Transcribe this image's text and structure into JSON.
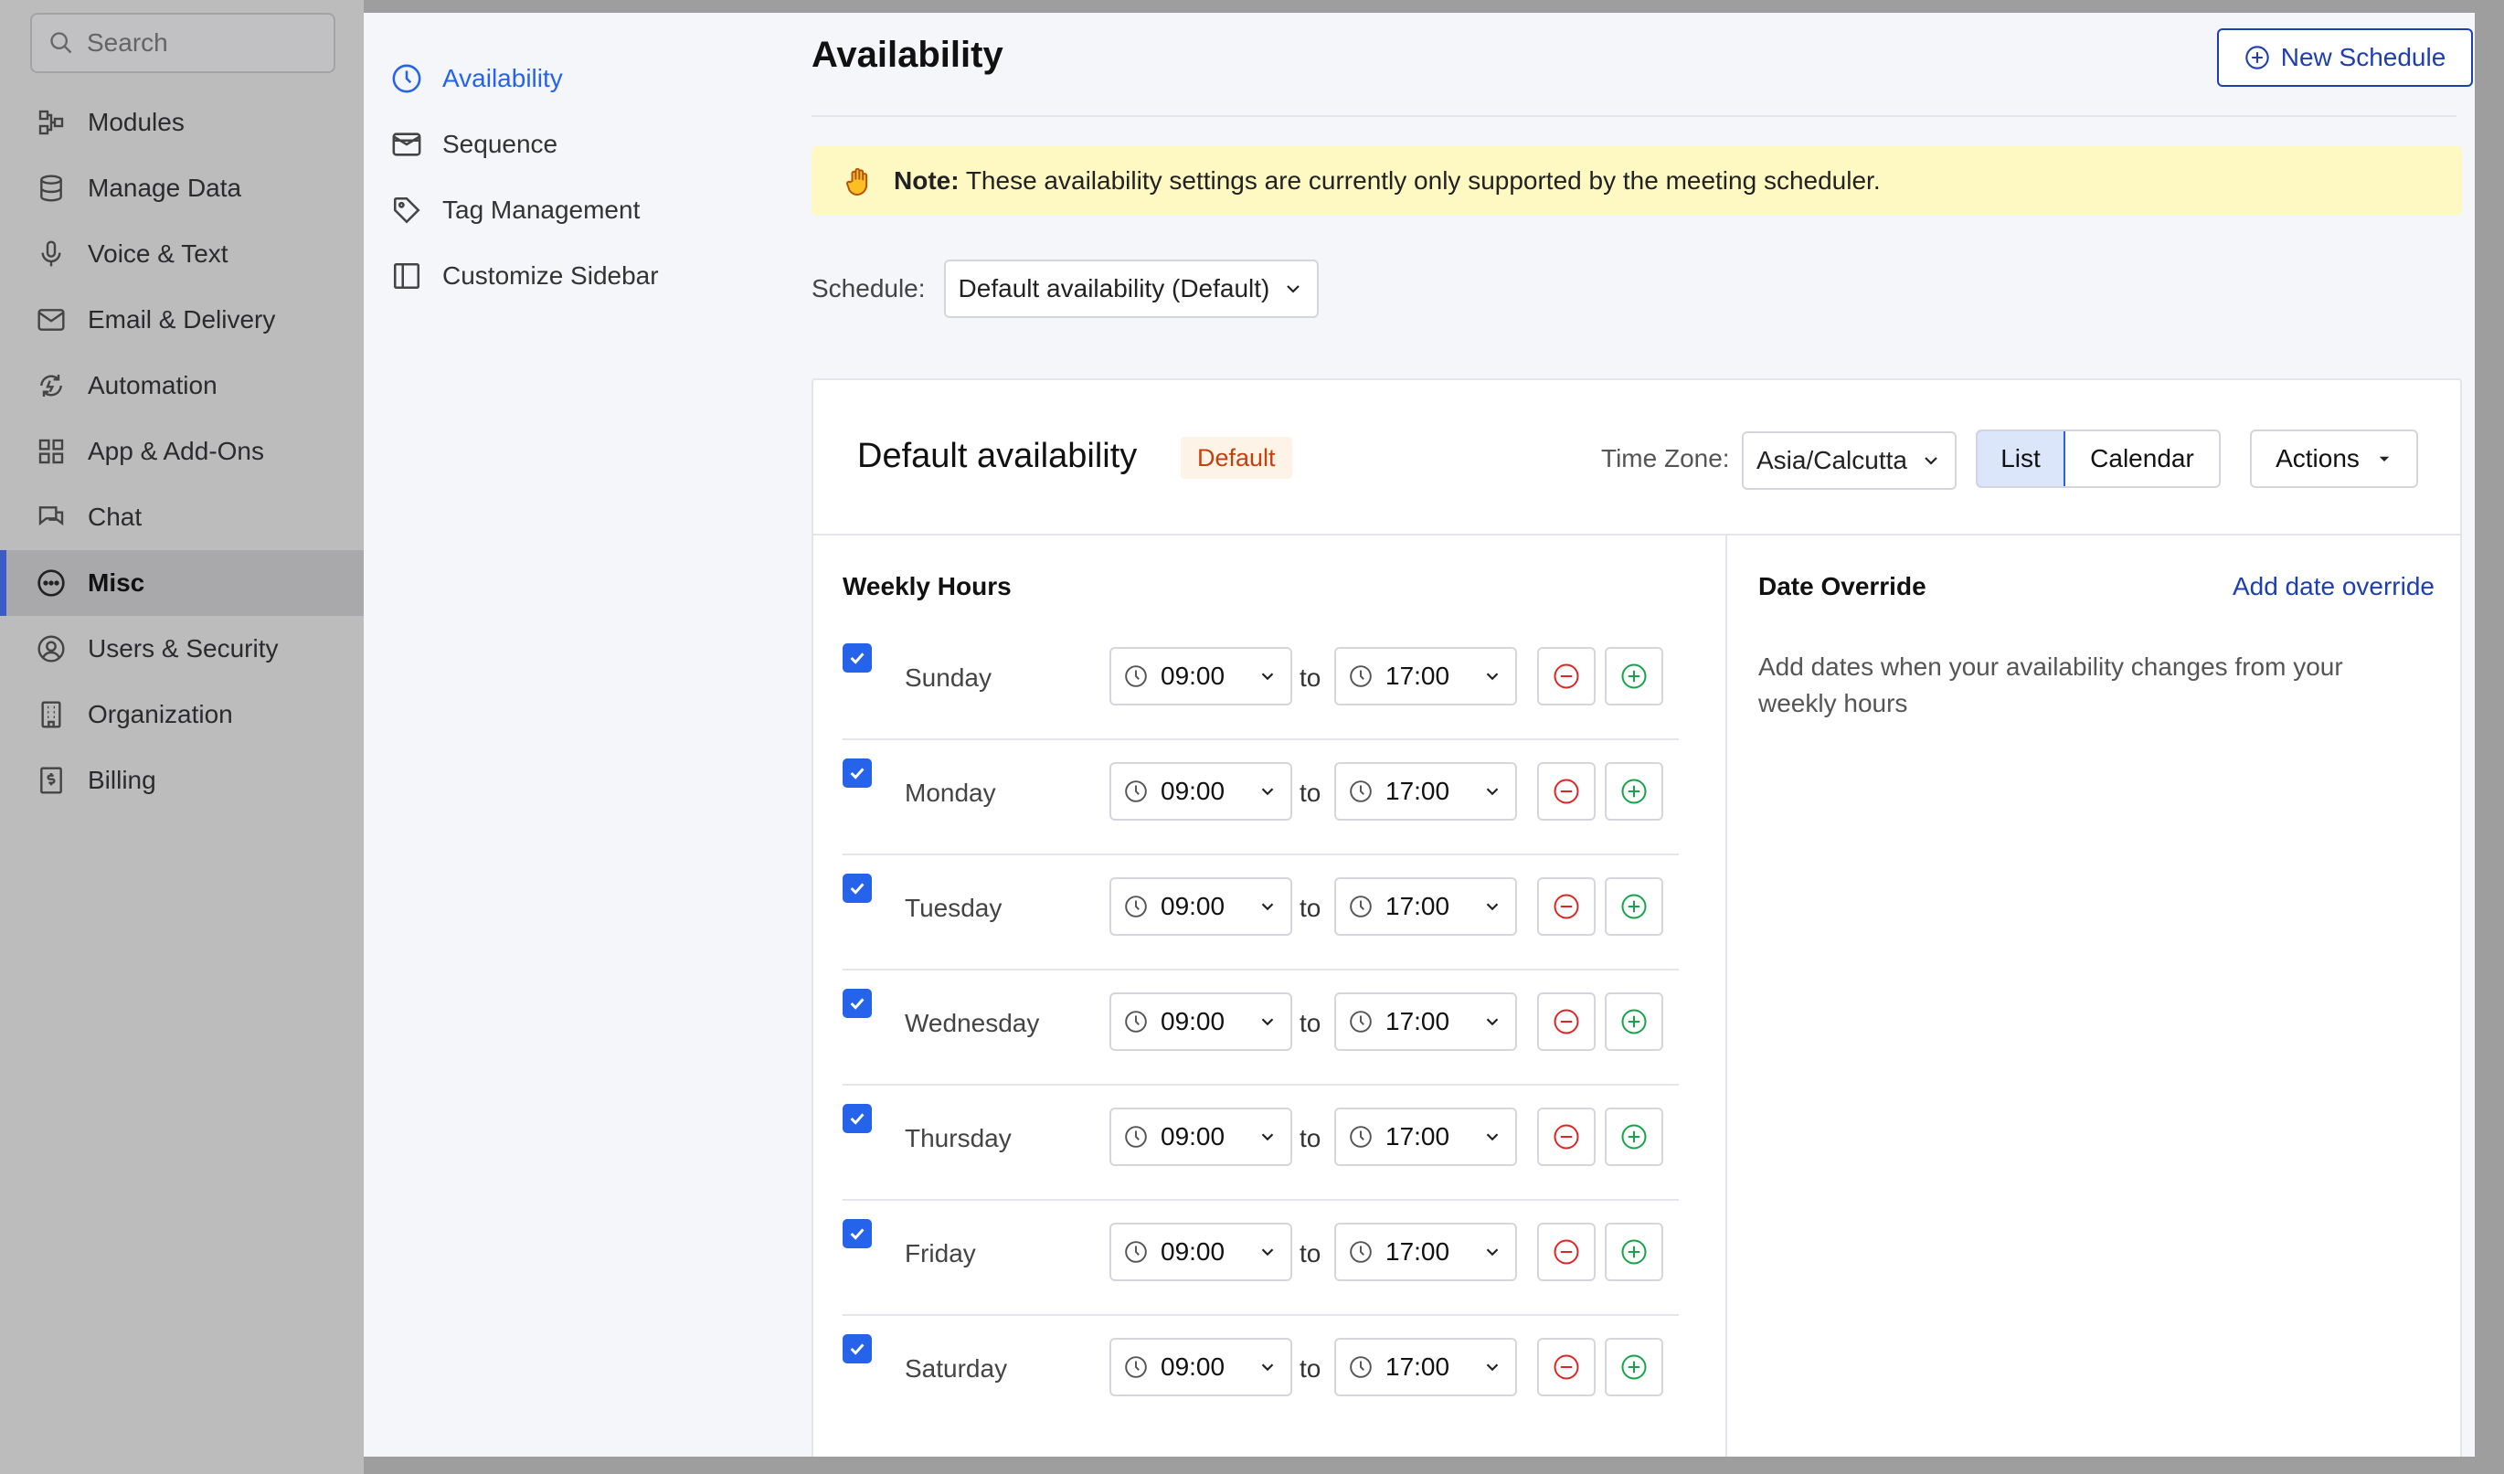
{
  "sidebar": {
    "search_placeholder": "Search",
    "items": [
      {
        "label": "Modules",
        "icon": "modules-icon"
      },
      {
        "label": "Manage Data",
        "icon": "database-icon"
      },
      {
        "label": "Voice & Text",
        "icon": "microphone-icon"
      },
      {
        "label": "Email & Delivery",
        "icon": "mail-icon"
      },
      {
        "label": "Automation",
        "icon": "automation-icon"
      },
      {
        "label": "App & Add-Ons",
        "icon": "apps-grid-icon"
      },
      {
        "label": "Chat",
        "icon": "chat-icon"
      },
      {
        "label": "Misc",
        "icon": "more-circle-icon",
        "active": true
      },
      {
        "label": "Users & Security",
        "icon": "user-circle-icon"
      },
      {
        "label": "Organization",
        "icon": "building-icon"
      },
      {
        "label": "Billing",
        "icon": "billing-icon"
      }
    ]
  },
  "subnav": {
    "items": [
      {
        "label": "Availability",
        "icon": "clock-icon",
        "active": true
      },
      {
        "label": "Sequence",
        "icon": "mail-icon"
      },
      {
        "label": "Tag Management",
        "icon": "tag-icon"
      },
      {
        "label": "Customize Sidebar",
        "icon": "sidebar-layout-icon"
      }
    ]
  },
  "header": {
    "title": "Availability",
    "new_schedule_label": "New Schedule"
  },
  "note": {
    "label": "Note:",
    "text": "These availability settings are currently only supported by the meeting scheduler."
  },
  "schedule": {
    "label": "Schedule:",
    "selected": "Default availability (Default)"
  },
  "card": {
    "title": "Default availability",
    "badge": "Default",
    "timezone_label": "Time Zone:",
    "timezone_value": "Asia/Calcutta",
    "view_list": "List",
    "view_calendar": "Calendar",
    "actions_label": "Actions"
  },
  "weekly": {
    "title": "Weekly Hours",
    "to_label": "to",
    "days": [
      {
        "name": "Sunday",
        "checked": true,
        "start": "09:00",
        "end": "17:00"
      },
      {
        "name": "Monday",
        "checked": true,
        "start": "09:00",
        "end": "17:00"
      },
      {
        "name": "Tuesday",
        "checked": true,
        "start": "09:00",
        "end": "17:00"
      },
      {
        "name": "Wednesday",
        "checked": true,
        "start": "09:00",
        "end": "17:00"
      },
      {
        "name": "Thursday",
        "checked": true,
        "start": "09:00",
        "end": "17:00"
      },
      {
        "name": "Friday",
        "checked": true,
        "start": "09:00",
        "end": "17:00"
      },
      {
        "name": "Saturday",
        "checked": true,
        "start": "09:00",
        "end": "17:00"
      }
    ]
  },
  "override": {
    "title": "Date Override",
    "add_link": "Add date override",
    "description": "Add dates when your availability changes from your weekly hours"
  },
  "colors": {
    "accent": "#2563eb",
    "link": "#1e40af",
    "note_bg": "#fef9c3",
    "badge_text": "#c2410c",
    "remove": "#dc2626",
    "add": "#16a34a"
  }
}
